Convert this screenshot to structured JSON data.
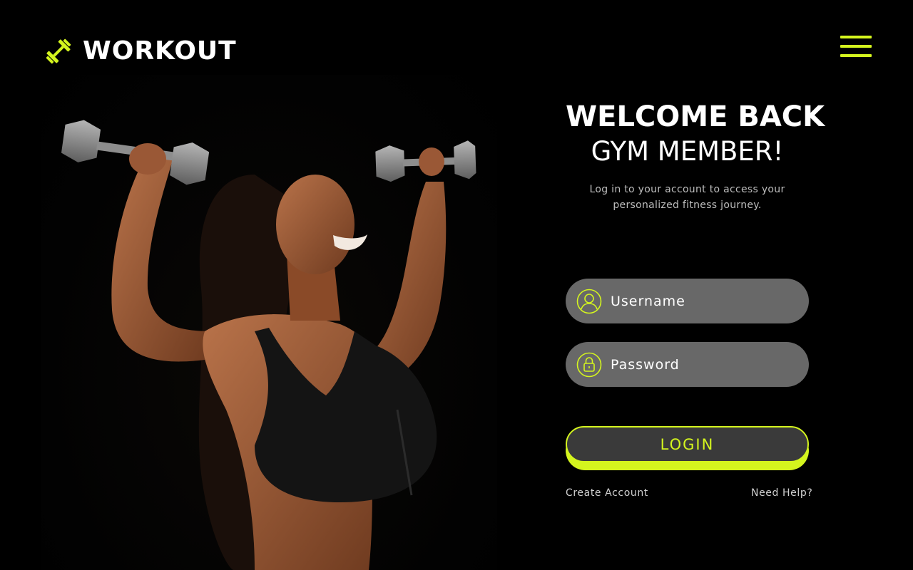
{
  "brand": {
    "name": "WORKOUT",
    "icon": "dumbbell-icon",
    "accent_color": "#d4f51e"
  },
  "nav": {
    "menu_icon": "hamburger-menu-icon"
  },
  "hero": {
    "image": "woman lifting dumbbells"
  },
  "login": {
    "title": "WELCOME BACK",
    "subtitle": "GYM MEMBER!",
    "tagline": "Log in to your account to access your personalized fitness journey.",
    "username": {
      "placeholder": "Username",
      "value": "",
      "icon": "user-icon"
    },
    "password": {
      "placeholder": "Password",
      "value": "",
      "icon": "lock-icon"
    },
    "submit_label": "LOGIN",
    "create_account_label": "Create Account",
    "help_label": "Need Help?"
  }
}
